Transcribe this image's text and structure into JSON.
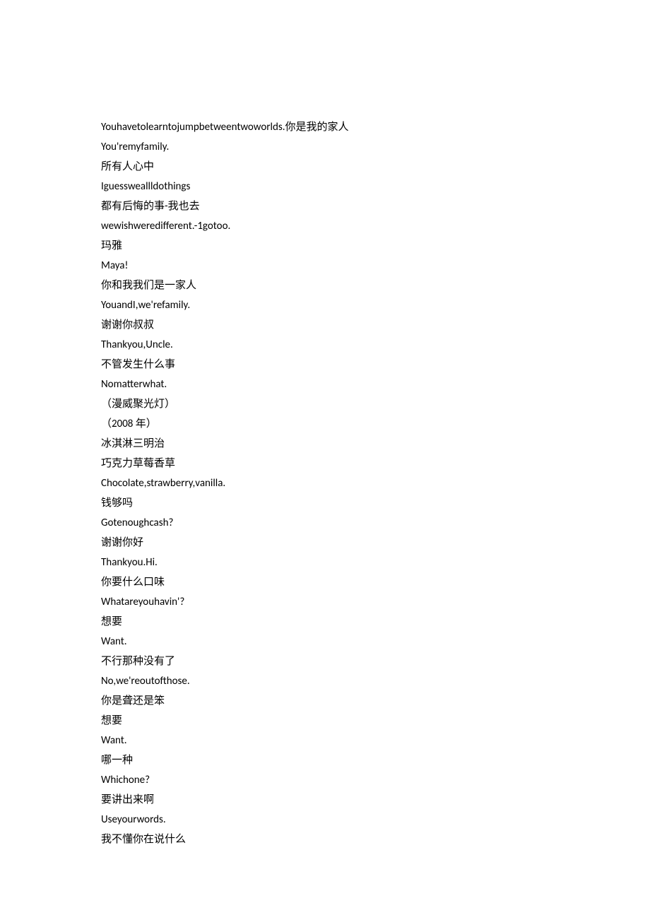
{
  "lines": [
    "Youhavetolearntojumpbetweentwoworlds.你是我的家人",
    "You'remyfamily.",
    "所有人心中",
    "Iguessweallldothings",
    "都有后悔的事-我也去",
    "wewishweredifferent.-1gotoo.",
    "玛雅",
    "Maya!",
    "你和我我们是一家人",
    "YouandI,we'refamily.",
    "谢谢你叔叔",
    "Thankyou,Uncle.",
    "不管发生什么事",
    "Nomatterwhat.",
    "（漫威聚光灯）",
    "（2008 年）",
    "冰淇淋三明治",
    "巧克力草莓香草",
    "Chocolate,strawberry,vanilla.",
    "钱够吗",
    "Gotenoughcash?",
    "谢谢你好",
    "Thankyou.Hi.",
    "你要什么口味",
    "Whatareyouhavin'?",
    "想要",
    "Want.",
    "不行那种没有了",
    "No,we'reoutofthose.",
    "你是聋还是笨",
    "想要",
    "Want.",
    "哪一种",
    "Whichone?",
    "要讲出来啊",
    "Useyourwords.",
    "我不懂你在说什么"
  ]
}
